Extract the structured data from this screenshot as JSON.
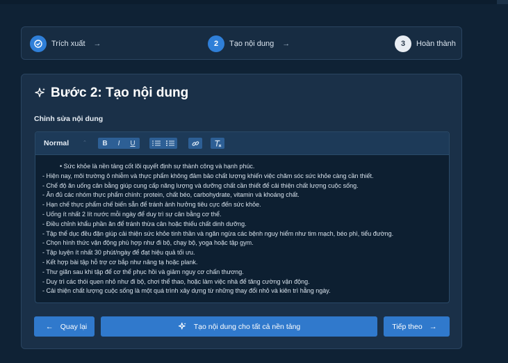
{
  "stepper": {
    "steps": [
      {
        "number": "",
        "label": "Trích xuất",
        "state": "done",
        "icon": "check-circle-icon"
      },
      {
        "number": "2",
        "label": "Tạo nội dung",
        "state": "active"
      },
      {
        "number": "3",
        "label": "Hoàn thành",
        "state": "pending"
      }
    ],
    "arrow": "→"
  },
  "main": {
    "title": "Bước 2: Tạo nội dung",
    "section_label": "Chỉnh sửa nội dung",
    "editor": {
      "format_value": "Normal",
      "format_caret": "⌃",
      "toolbar": {
        "bold": "B",
        "italic": "I",
        "underline": "U",
        "ordered_list": "☰",
        "bullet_list": "☰",
        "link": "🔗",
        "clear": "Tx"
      },
      "lines": [
        "• Sức khỏe là nền tảng cốt lõi quyết định sự thành công và hạnh phúc.",
        "- Hiện nay, môi trường ô nhiễm và thực phẩm không đảm bảo chất lượng khiến việc chăm sóc sức khỏe càng cần thiết.",
        "- Chế độ ăn uống cân bằng giúp cung cấp năng lượng và dưỡng chất cần thiết để cải thiện chất lượng cuộc sống.",
        "- Ăn đủ các nhóm thực phẩm chính: protein, chất béo, carbohydrate, vitamin và khoáng chất.",
        "- Hạn chế thực phẩm chế biến sẵn để tránh ảnh hưởng tiêu cực đến sức khỏe.",
        "- Uống ít nhất 2 lít nước mỗi ngày để duy trì sự cân bằng cơ thể.",
        "- Điều chỉnh khẩu phần ăn để tránh thừa cân hoặc thiếu chất dinh dưỡng.",
        "- Tập thể dục đều đặn giúp cải thiện sức khỏe tinh thần và ngăn ngừa các bệnh nguy hiểm như tim mạch, béo phì, tiểu đường.",
        "- Chọn hình thức vận động phù hợp như đi bộ, chạy bộ, yoga hoặc tập gym.",
        "- Tập luyện ít nhất 30 phút/ngày để đạt hiệu quả tối ưu.",
        "- Kết hợp bài tập hỗ trợ cơ bắp như nâng tạ hoặc plank.",
        "- Thư giãn sau khi tập để cơ thể phục hồi và giảm nguy cơ chấn thương.",
        "- Duy trì các thói quen nhỏ như đi bộ, chơi thể thao, hoặc làm việc nhà để tăng cường vận động.",
        "- Cải thiện chất lượng cuộc sống là một quá trình xây dựng từ những thay đổi nhỏ và kiên trì hằng ngày."
      ]
    },
    "buttons": {
      "back": {
        "label": "Quay lại",
        "icon": "←"
      },
      "generate": {
        "label": "Tạo nội dung cho tất cả nền tảng",
        "icon": "sparkle-icon"
      },
      "next": {
        "label": "Tiếp theo",
        "icon": "→"
      }
    }
  },
  "colors": {
    "accent": "#3079cc",
    "background": "#0f2235",
    "card": "#1a3048"
  }
}
